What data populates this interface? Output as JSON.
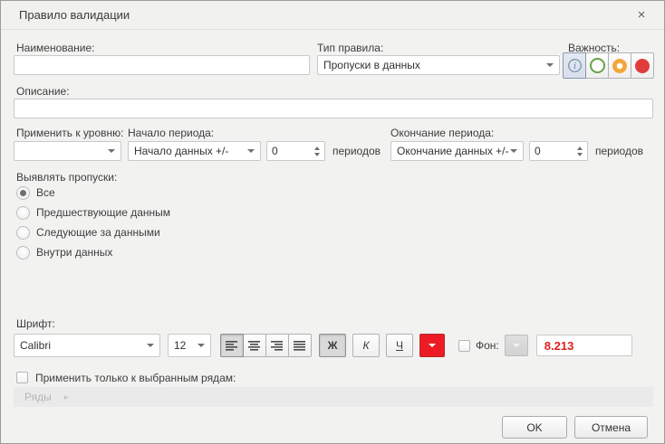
{
  "dialog": {
    "title": "Правило валидации",
    "close_glyph": "×"
  },
  "name_field": {
    "label": "Наименование:",
    "value": ""
  },
  "rule_type": {
    "label": "Тип правила:",
    "value": "Пропуски в данных"
  },
  "importance": {
    "label": "Важность:"
  },
  "description": {
    "label": "Описание:",
    "value": ""
  },
  "apply_level": {
    "label": "Применить к уровню:",
    "value": ""
  },
  "period_start": {
    "label": "Начало периода:",
    "value": "Начало данных +/-",
    "offset": "0",
    "units": "периодов"
  },
  "period_end": {
    "label": "Окончание периода:",
    "value": "Окончание данных +/-",
    "offset": "0",
    "units": "периодов"
  },
  "gaps": {
    "label": "Выявлять пропуски:",
    "options": [
      {
        "label": "Все",
        "selected": true
      },
      {
        "label": "Предшествующие данным",
        "selected": false
      },
      {
        "label": "Следующие за данными",
        "selected": false
      },
      {
        "label": "Внутри данных",
        "selected": false
      }
    ]
  },
  "font": {
    "label": "Шрифт:",
    "family": "Calibri",
    "size": "12",
    "bold": "Ж",
    "italic": "К",
    "underline": "Ч",
    "background_label": "Фон:",
    "preview": "8.213"
  },
  "series": {
    "checkbox_label": "Применить только к выбранным рядам:",
    "breadcrumb": "Ряды",
    "breadcrumb_arrow": "▸"
  },
  "footer": {
    "ok": "OK",
    "cancel": "Отмена"
  },
  "colors": {
    "importance_info": "#8293ad",
    "importance_ok": "#68a247",
    "importance_warning": "#f3a73a",
    "importance_error": "#e13c3c",
    "font_color_selected": "#ed1c24",
    "preview_text": "#e01e1e"
  }
}
